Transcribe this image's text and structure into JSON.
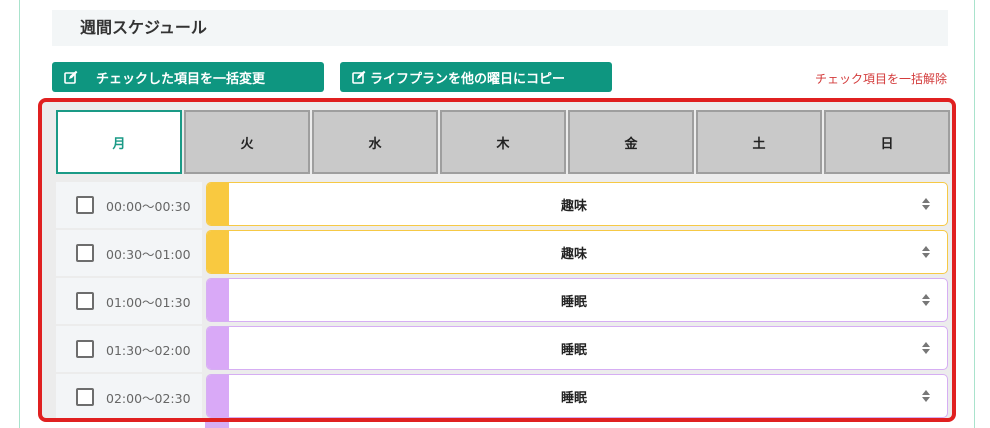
{
  "section": {
    "title": "週間スケジュール"
  },
  "toolbar": {
    "bulk_change_label": "チェックした項目を一括変更",
    "copy_label": "ライフプランを他の曜日にコピー",
    "clear_checks_label": "チェック項目を一括解除"
  },
  "days": [
    {
      "label": "月",
      "active": true
    },
    {
      "label": "火"
    },
    {
      "label": "水"
    },
    {
      "label": "木"
    },
    {
      "label": "金"
    },
    {
      "label": "土"
    },
    {
      "label": "日"
    }
  ],
  "slots": [
    {
      "time": "00:00〜00:30",
      "activity": "趣味",
      "color": "#f9c940"
    },
    {
      "time": "00:30〜01:00",
      "activity": "趣味",
      "color": "#f9c940"
    },
    {
      "time": "01:00〜01:30",
      "activity": "睡眠",
      "color": "#d9a9f7"
    },
    {
      "time": "01:30〜02:00",
      "activity": "睡眠",
      "color": "#d9a9f7"
    },
    {
      "time": "02:00〜02:30",
      "activity": "睡眠",
      "color": "#d9a9f7"
    }
  ],
  "icons": {
    "edit": "edit-icon",
    "sort": "sort-icon"
  }
}
